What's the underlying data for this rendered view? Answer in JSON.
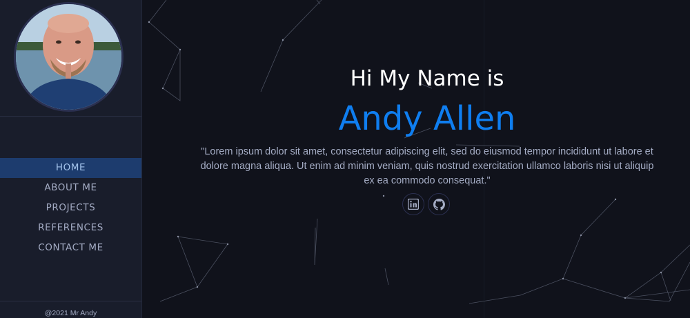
{
  "profile": {
    "avatar_alt": "Profile photo"
  },
  "nav": {
    "items": [
      {
        "label": "HOME",
        "active": true
      },
      {
        "label": "ABOUT ME",
        "active": false
      },
      {
        "label": "PROJECTS",
        "active": false
      },
      {
        "label": "REFERENCES",
        "active": false
      },
      {
        "label": "CONTACT ME",
        "active": false
      }
    ]
  },
  "footer": {
    "copyright": "@2021 Mr Andy"
  },
  "hero": {
    "greeting": "Hi My Name is",
    "name": "Andy Allen",
    "bio": "\"Lorem ipsum dolor sit amet, consectetur adipiscing elit, sed do eiusmod tempor incididunt ut labore et dolore magna aliqua. Ut enim ad minim veniam, quis nostrud exercitation ullamco laboris nisi ut aliquip ex ea commodo consequat.\""
  },
  "socials": [
    {
      "icon": "linkedin-icon"
    },
    {
      "icon": "github-icon"
    }
  ],
  "colors": {
    "accent": "#0f7ef0",
    "sidebar_bg": "#191d2b",
    "page_bg": "#10121b",
    "text_muted": "#a4acc4",
    "active_nav_bg": "#1d3c6e"
  }
}
